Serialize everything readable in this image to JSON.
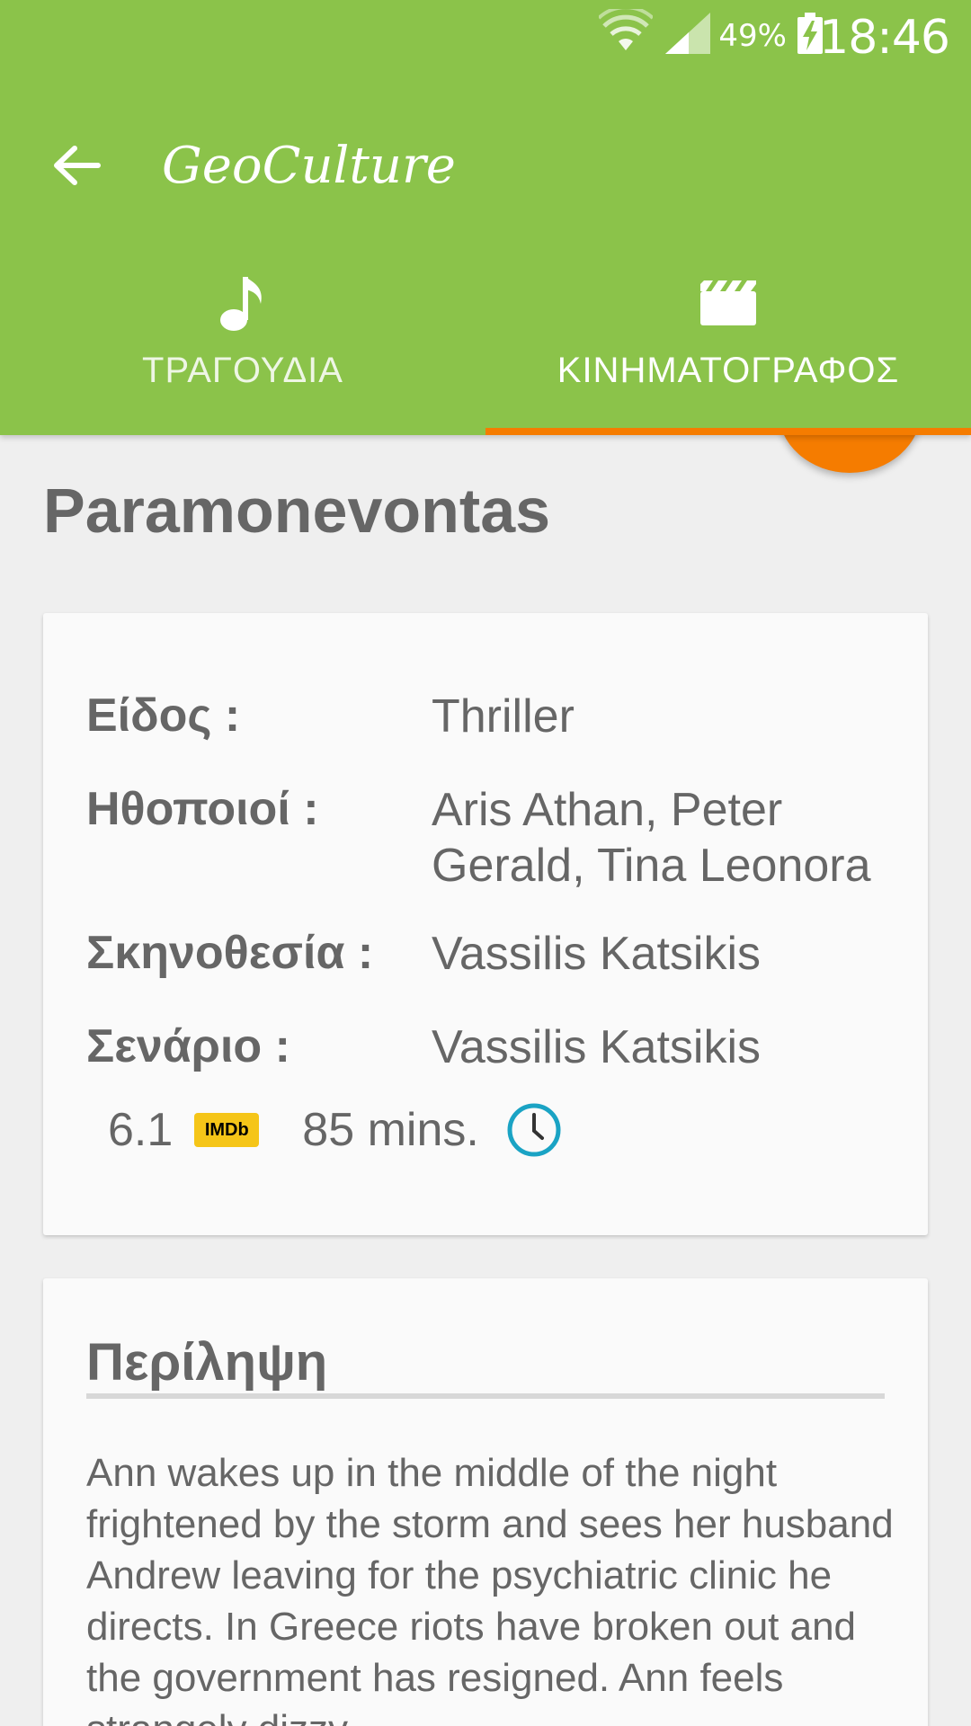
{
  "status_bar": {
    "battery_percent": "49%",
    "time": "18:46",
    "icons": [
      "wifi-icon",
      "signal-icon",
      "battery-charging-icon"
    ]
  },
  "toolbar": {
    "title": "GeoCulture",
    "back_icon": "arrow-back-icon"
  },
  "tabs": [
    {
      "label": "ΤΡΑΓΟΥΔΙΑ",
      "icon": "music-note-icon",
      "selected": false
    },
    {
      "label": "ΚΙΝΗΜΑΤΟΓΡΑΦΟΣ",
      "icon": "movie-clapper-icon",
      "selected": true
    }
  ],
  "colors": {
    "primary": "#8bc34a",
    "accent": "#f57c00",
    "text": "#666666",
    "imdb": "#f5c518",
    "clock": "#1aa3c4"
  },
  "movie": {
    "title": "Paramonevontas",
    "details": [
      {
        "label": "Είδος :",
        "value": "Thriller"
      },
      {
        "label": "Ηθοποιοί :",
        "value": " Aris Athan, Peter Gerald, Tina Leonora"
      },
      {
        "label": "Σκηνοθεσία :",
        "value": " Vassilis Katsikis"
      },
      {
        "label": "Σενάριο :",
        "value": "Vassilis Katsikis"
      }
    ],
    "rating": "6.1",
    "imdb_badge": "IMDb",
    "duration": "85 mins."
  },
  "summary": {
    "title": "Περίληψη",
    "text": "Ann wakes up in the middle of the night frightened by the storm and sees her husband Andrew leaving for the psychiatric clinic he directs. In Greece riots have broken out and the government has resigned. Ann feels strangely dizzy"
  }
}
